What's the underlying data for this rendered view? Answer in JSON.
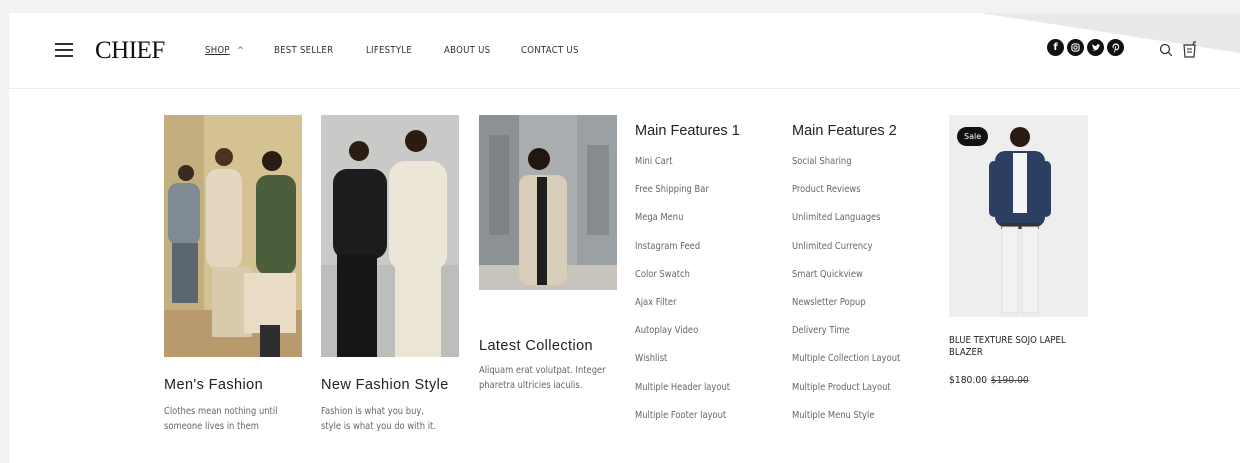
{
  "header": {
    "logo": "CHIEF",
    "nav": [
      {
        "label": "SHOP",
        "active": true
      },
      {
        "label": "BEST SELLER"
      },
      {
        "label": "LIFESTYLE"
      },
      {
        "label": "ABOUT US"
      },
      {
        "label": "CONTACT US"
      }
    ],
    "socials": [
      "facebook-icon",
      "instagram-icon",
      "twitter-icon",
      "pinterest-icon"
    ]
  },
  "mega_menu": {
    "tiles": [
      {
        "title": "Men's Fashion",
        "desc": "Clothes mean nothing until someone lives in them"
      },
      {
        "title": "New Fashion Style",
        "desc": "Fashion is what you buy, style is what you do with it."
      },
      {
        "title": "Latest Collection",
        "desc": "Aliquam erat volutpat. Integer pharetra ultricies iaculis."
      }
    ],
    "features1": {
      "title": "Main Features 1",
      "items": [
        "Mini Cart",
        "Free Shipping Bar",
        "Mega Menu",
        "Instagram Feed",
        "Color Swatch",
        "Ajax Filter",
        "Autoplay Video",
        "Wishlist",
        "Multiple Header layout",
        "Multiple Footer layout"
      ]
    },
    "features2": {
      "title": "Main Features 2",
      "items": [
        "Social Sharing",
        "Product Reviews",
        "Unlimited Languages",
        "Unlimited Currency",
        "Smart Quickview",
        "Newsletter Popup",
        "Delivery Time",
        "Multiple Collection Layout",
        "Multiple Product Layout",
        "Multiple Menu Style"
      ]
    },
    "product": {
      "badge": "Sale",
      "title": "BLUE TEXTURE SOJO LAPEL BLAZER",
      "price": "$180.00",
      "old_price": "$190.00"
    }
  }
}
